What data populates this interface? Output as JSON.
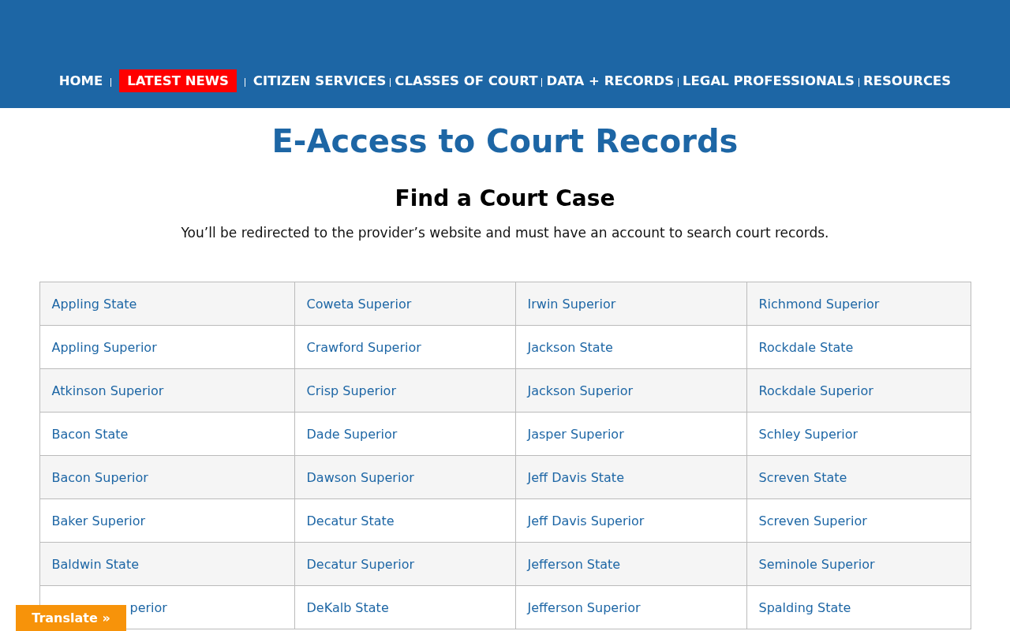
{
  "nav": [
    {
      "label": "HOME",
      "selected": false
    },
    {
      "label": "LATEST NEWS",
      "selected": true
    },
    {
      "label": "CITIZEN SERVICES",
      "selected": false
    },
    {
      "label": "CLASSES OF COURT",
      "selected": false
    },
    {
      "label": "DATA + RECORDS",
      "selected": false
    },
    {
      "label": "LEGAL PROFESSIONALS",
      "selected": false
    },
    {
      "label": "RESOURCES",
      "selected": false
    }
  ],
  "title": "E-Access to Court Records",
  "heading": "Find a Court Case",
  "intro": "You’ll be redirected to the provider’s website and must have an account to search court records.",
  "courts": [
    [
      {
        "text": "Appling State"
      },
      {
        "text": "Coweta Superior"
      },
      {
        "text": "Irwin Superior"
      },
      {
        "text": "Richmond Superior"
      }
    ],
    [
      {
        "text": "Appling Superior"
      },
      {
        "text": "Crawford Superior"
      },
      {
        "text": "Jackson State"
      },
      {
        "text": "Rockdale State"
      }
    ],
    [
      {
        "text": "Atkinson Superior"
      },
      {
        "text": "Crisp Superior"
      },
      {
        "text": "Jackson Superior"
      },
      {
        "text": "Rockdale Superior"
      }
    ],
    [
      {
        "text": "Bacon State"
      },
      {
        "text": "Dade Superior"
      },
      {
        "text": "Jasper Superior"
      },
      {
        "text": "Schley Superior"
      }
    ],
    [
      {
        "text": "Bacon Superior"
      },
      {
        "text": "Dawson Superior"
      },
      {
        "text": "Jeff Davis State"
      },
      {
        "text": "Screven State"
      }
    ],
    [
      {
        "text": "Baker Superior"
      },
      {
        "text": "Decatur State"
      },
      {
        "text": "Jeff Davis Superior"
      },
      {
        "text": "Screven Superior"
      }
    ],
    [
      {
        "text": "Baldwin State"
      },
      {
        "text": "Decatur Superior"
      },
      {
        "text": "Jefferson State"
      },
      {
        "text": "Seminole Superior"
      }
    ],
    [
      {
        "text": "perior",
        "covered": true
      },
      {
        "text": "DeKalb State"
      },
      {
        "text": "Jefferson Superior"
      },
      {
        "text": "Spalding State"
      }
    ]
  ],
  "translate": "Translate »"
}
